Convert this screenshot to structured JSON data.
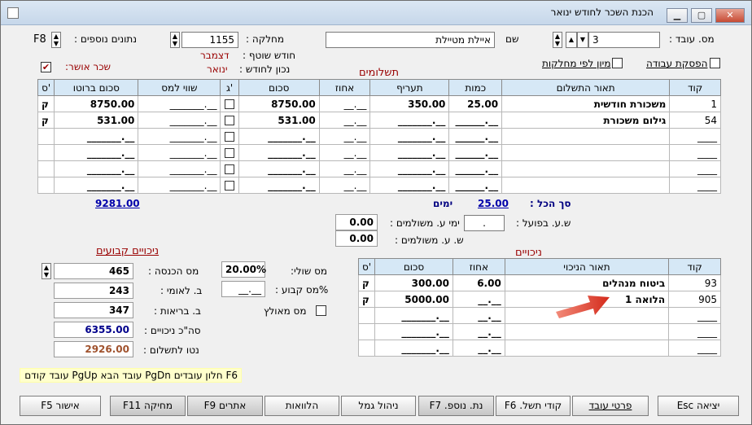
{
  "window": {
    "title": "הכנת השכר לחודש ינואר"
  },
  "header": {
    "employee_no_label": "מס. עובד :",
    "employee_no_value": "3",
    "name_label": "שם",
    "name_value": "איילת מטיילת",
    "department_label": "מחלקה :",
    "department_value": "1155",
    "extra_data_label": "נתונים נוספים :",
    "extra_data_value": "F8",
    "current_month_label": "חודש שוטף :",
    "current_month_value": "דצמבר",
    "correct_for_month_label": "נכון לחודש :",
    "correct_for_month_value": "ינואר",
    "approved_salary_label": "שכר אושר:",
    "approved_salary_checked": "✔",
    "work_stop_label": "הפסקת עבודה",
    "sort_by_dept_label": "מיון לפי מחלקות"
  },
  "payments": {
    "section_title": "תשלומים",
    "columns": [
      "קוד",
      "תאור התשלום",
      "כמות",
      "תעריף",
      "אחוז",
      "סכום",
      "ג'",
      "שווי למס",
      "סכום ברוטו",
      "ס'"
    ],
    "rows": [
      {
        "code": "1",
        "desc": "משכורת חודשית",
        "qty": "25.00",
        "rate": "350.00",
        "pct": "__.__",
        "amount": "8750.00",
        "value_tax": "_______.__",
        "gross": "8750.00",
        "s": "ק"
      },
      {
        "code": "54",
        "desc": "גילום משכורת",
        "qty": "______.__",
        "rate": "_______.__",
        "pct": "__.__",
        "amount": "531.00",
        "value_tax": "_______.__",
        "gross": "531.00",
        "s": "ק"
      },
      {
        "code": "____",
        "desc": "",
        "qty": "______.__",
        "rate": "_______.__",
        "pct": "__.__",
        "amount": "_______.__",
        "value_tax": "_______.__",
        "gross": "_______.__",
        "s": ""
      },
      {
        "code": "____",
        "desc": "",
        "qty": "______.__",
        "rate": "_______.__",
        "pct": "__.__",
        "amount": "_______.__",
        "value_tax": "_______.__",
        "gross": "_______.__",
        "s": ""
      },
      {
        "code": "____",
        "desc": "",
        "qty": "______.__",
        "rate": "_______.__",
        "pct": "__.__",
        "amount": "_______.__",
        "value_tax": "_______.__",
        "gross": "_______.__",
        "s": ""
      },
      {
        "code": "____",
        "desc": "",
        "qty": "______.__",
        "rate": "_______.__",
        "pct": "__.__",
        "amount": "_______.__",
        "value_tax": "_______.__",
        "gross": "_______.__",
        "s": ""
      }
    ],
    "total_label": "סך הכל :",
    "total_days": "25.00",
    "days_label": "ימים",
    "total_gross": "9281.00"
  },
  "days": {
    "actual_work_days_label": "ש.ע. בפועל :",
    "actual_work_days_value": ".",
    "paid_days_label": "ימי ע. משולמים :",
    "paid_days_value": "0.00",
    "paid_hours_label": "ש. ע. משולמים :",
    "paid_hours_value": "0.00"
  },
  "fixed_deductions": {
    "section_title": "ניכויים קבועים",
    "income_tax_label": "מס הכנסה :",
    "income_tax_value": "465",
    "nat_ins_label": "ב. לאומי :",
    "nat_ins_value": "243",
    "health_label": "ב. בריאות :",
    "health_value": "347",
    "total_deductions_label": "סה\"כ ניכויים :",
    "total_deductions_value": "6355.00",
    "net_pay_label": "נטו לתשלום :",
    "net_pay_value": "2926.00",
    "marginal_tax_label": "מס שולי:",
    "marginal_tax_value": "20.00%",
    "fixed_tax_label": "%מס קבוע :",
    "fixed_tax_value": "__.__",
    "forced_tax_label": "מס מאולץ"
  },
  "deductions": {
    "section_title": "ניכויים",
    "columns": [
      "קוד",
      "תאור הניכוי",
      "אחוז",
      "סכום",
      "ס'"
    ],
    "rows": [
      {
        "code": "93",
        "desc": "ביטוח מנהלים",
        "pct": "6.00",
        "amount": "300.00",
        "s": "ק"
      },
      {
        "code": "905",
        "desc": "הלואה 1",
        "pct": "__.__",
        "amount": "5000.00",
        "s": "ק"
      },
      {
        "code": "____",
        "desc": "",
        "pct": "__.__",
        "amount": "_______.__",
        "s": ""
      },
      {
        "code": "____",
        "desc": "",
        "pct": "__.__",
        "amount": "_______.__",
        "s": ""
      },
      {
        "code": "____",
        "desc": "",
        "pct": "__.__",
        "amount": "_______.__",
        "s": ""
      }
    ]
  },
  "hint_bar": "F6 חלון עובדים  PgDn עובד הבא  PgUp עובד קודם",
  "buttons": {
    "exit": "יציאה Esc",
    "employee_details": "פרטי עובד",
    "payment_codes": "קודי תשל. F6",
    "extra_data": "נת. נוספ. F7",
    "pension_mgmt": "ניהול גמל",
    "loans": "הלוואות",
    "warnings": "אתרים F9",
    "delete": "מחיקה F11",
    "confirm": "אישור F5"
  },
  "colors": {
    "header_fill": "#d6e8f6",
    "red_label": "#990000",
    "net_color": "#a0522d",
    "deduction_color": "#00008b",
    "arrow": "#e53b2c"
  }
}
